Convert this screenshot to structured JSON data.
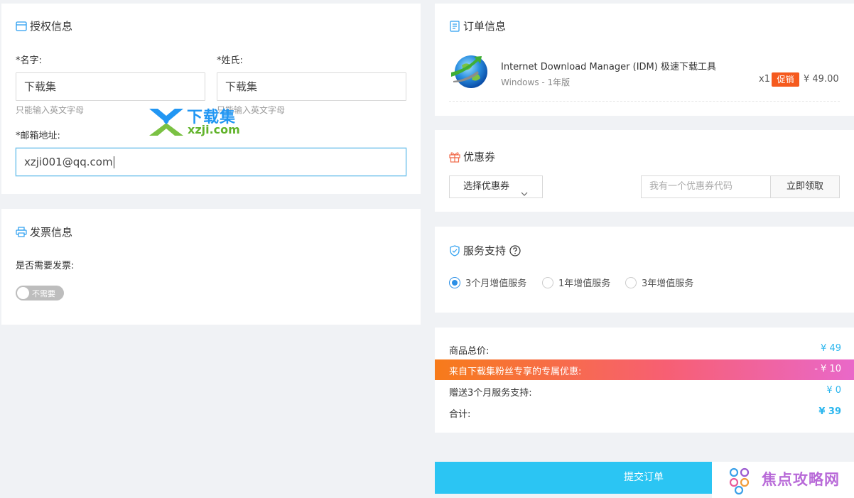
{
  "license": {
    "title": "授权信息",
    "first_name_label": "*名字:",
    "first_name_value": "下载集",
    "first_name_hint": "只能输入英文字母",
    "last_name_label": "*姓氏:",
    "last_name_value": "下载集",
    "last_name_hint": "只能输入英文字母",
    "email_label": "*邮箱地址:",
    "email_value": "xzji001@qq.com"
  },
  "invoice": {
    "title": "发票信息",
    "question": "是否需要发票:",
    "toggle_label": "不需要"
  },
  "order": {
    "title": "订单信息",
    "product_name": "Internet Download Manager (IDM) 极速下载工具",
    "product_desc": "Windows - 1年版",
    "qty": "x1",
    "badge": "促销",
    "price": "¥ 49.00"
  },
  "coupon": {
    "title": "优惠券",
    "select_label": "选择优惠券",
    "code_placeholder": "我有一个优惠券代码",
    "claim_button": "立即领取"
  },
  "service": {
    "title": "服务支持",
    "options": [
      "3个月增值服务",
      "1年增值服务",
      "3年增值服务"
    ],
    "selected_index": 0
  },
  "summary": {
    "subtotal_label": "商品总价:",
    "subtotal_value": "¥ 49",
    "discount_label": "来自下载集粉丝专享的专属优惠:",
    "discount_value": "- ¥ 10",
    "gift_label": "赠送3个月服务支持:",
    "gift_value": "¥ 0",
    "total_label": "合计:",
    "total_value": "¥ 39"
  },
  "submit_label": "提交订单",
  "watermarks": {
    "xzji_cn": "下载集",
    "xzji_domain": "xzji.com",
    "jiaodian": "焦点攻略网"
  },
  "colors": {
    "accent": "#2bc5f3",
    "promo_badge": "#f55a1e",
    "gradient_start": "#f77b1a",
    "gradient_end": "#e968c9",
    "radio_on": "#2b8fe6"
  }
}
